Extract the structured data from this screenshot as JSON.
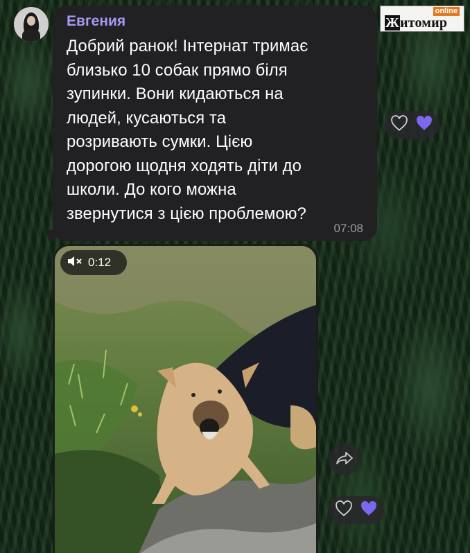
{
  "chat": {
    "sender": "Евгения",
    "message": "Добрий ранок! Інтернат тримає близько 10 собак прямо біля зупинки. Вони кидаються на людей, кусаються та розривають сумки. Цією дорогою щодня ходять діти до школи. До кого можна звернутися з цією проблемою?",
    "message_lines": [
      "Добрий ранок! Інтернат тримає",
      "близько 10 собак прямо біля",
      "зупинки. Вони кидаються на",
      "людей, кусаються та",
      "розривають сумки. Цією",
      "дорогою щодня ходять діти до",
      "школи. До кого можна",
      "звернутися з цією проблемою?"
    ],
    "time": "07:08"
  },
  "video": {
    "duration": "0:12",
    "muted": true
  },
  "watermark": {
    "badge": "online",
    "city": "Житомир"
  },
  "reactions": [
    "heart-outline-icon",
    "heart-filled-icon"
  ],
  "colors": {
    "sender_name": "#a99af5",
    "bubble_bg": "#212124",
    "heart_filled": "#7b68ee",
    "logo_badge": "#e5791f"
  }
}
